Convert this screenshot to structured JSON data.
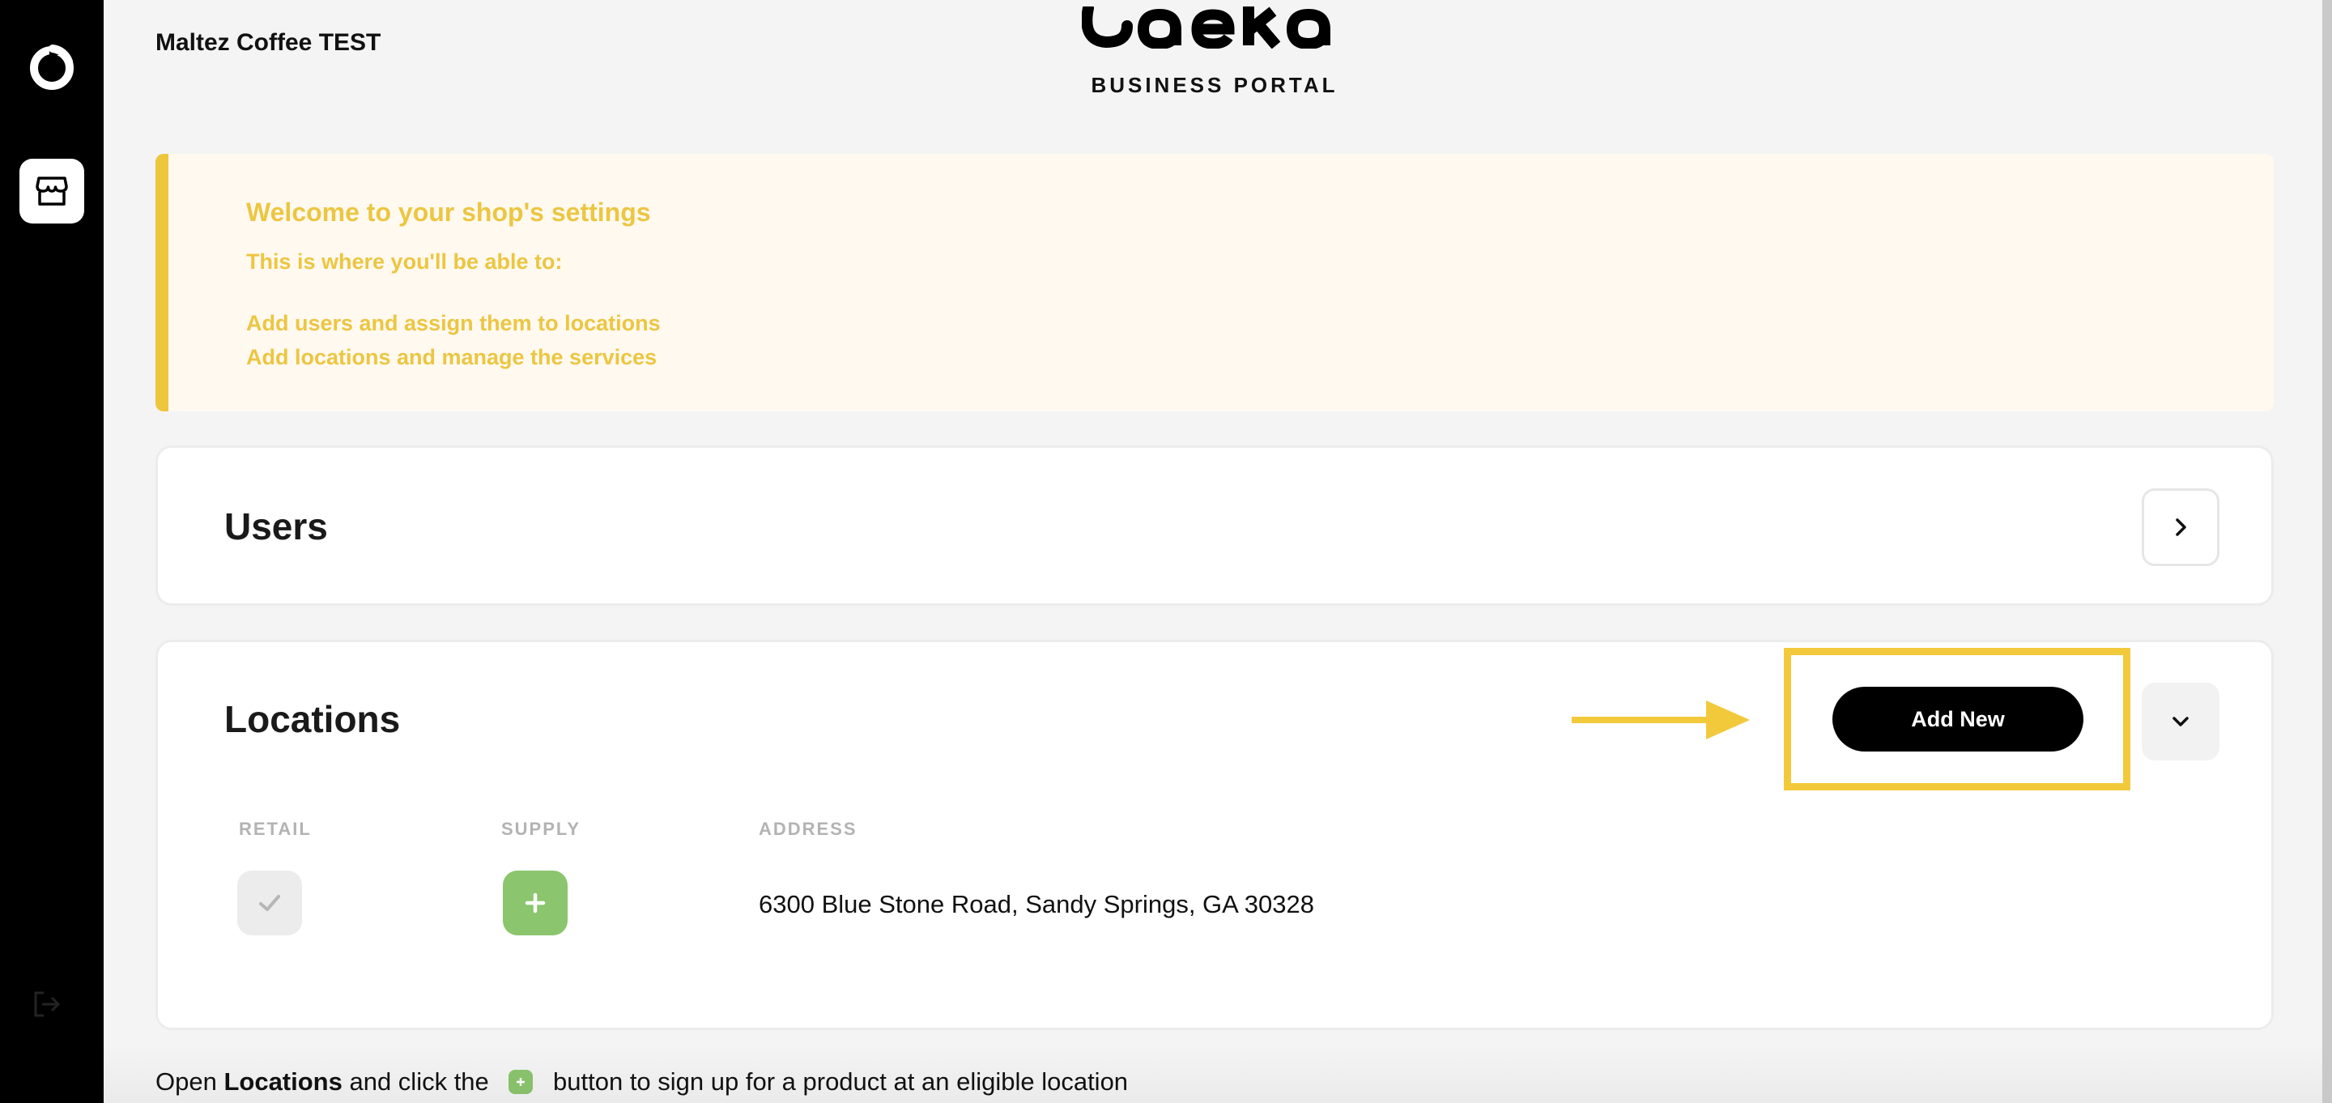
{
  "app": {
    "shop_name": "Maltez Coffee TEST",
    "portal_label": "BUSINESS PORTAL",
    "logo_name": "oaeko"
  },
  "sidebar": {
    "items": [
      {
        "icon": "brand-icon"
      },
      {
        "icon": "storefront-icon",
        "active": true
      },
      {
        "icon": "logout-icon"
      }
    ]
  },
  "banner": {
    "title": "Welcome to your shop's settings",
    "intro": "This is where you'll be able to:",
    "bullets": [
      "Add users and assign them to locations",
      "Add locations and manage the services"
    ],
    "accent_color": "#eec63d"
  },
  "users": {
    "title": "Users",
    "expand_icon": "chevron-right-icon"
  },
  "locations": {
    "title": "Locations",
    "add_new_label": "Add New",
    "expand_icon": "chevron-down-icon",
    "columns": [
      "RETAIL",
      "SUPPLY",
      "ADDRESS"
    ],
    "rows": [
      {
        "retail": "check-icon",
        "supply": "plus-icon",
        "address": "6300 Blue Stone Road, Sandy Springs, GA 30328"
      }
    ]
  },
  "caption": {
    "prefix": "Open ",
    "bold": "Locations",
    "middle": " and click the ",
    "suffix": " button to sign up for a product at an eligible location"
  },
  "colors": {
    "highlight": "#f3c93c",
    "supply_green": "#8bc56d",
    "sidebar_bg": "#000000"
  }
}
